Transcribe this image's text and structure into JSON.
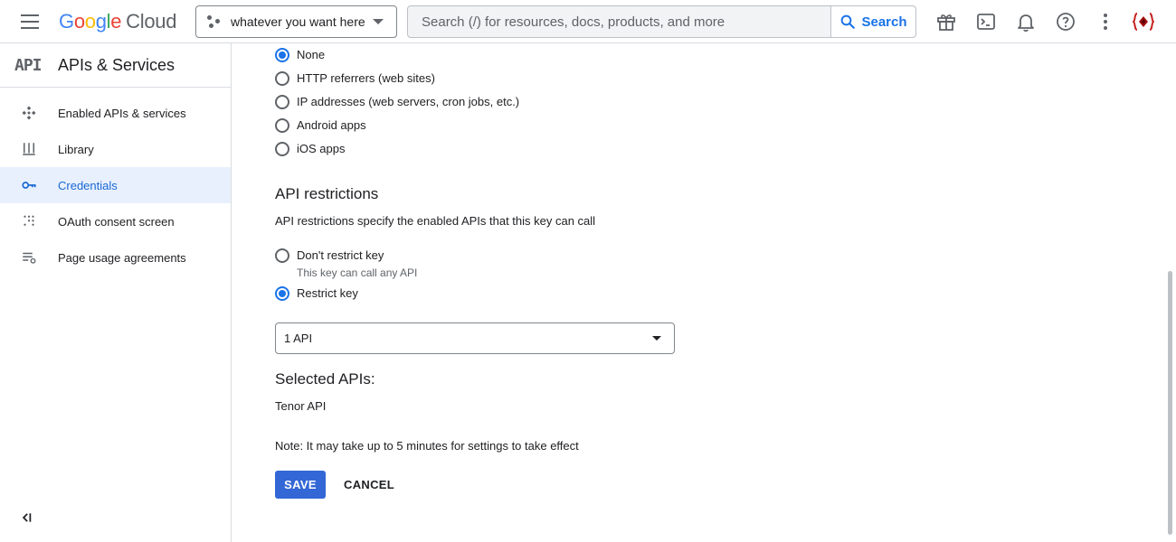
{
  "header": {
    "logo": {
      "G": "G",
      "o1": "o",
      "o2": "o",
      "g": "g",
      "l": "l",
      "e": "e",
      "cloud": "Cloud"
    },
    "project": "whatever you want here",
    "search": {
      "placeholder": "Search (/) for resources, docs, products, and more",
      "button_label": "Search"
    },
    "icons": [
      "gift-icon",
      "cloud-shell-icon",
      "notifications-icon",
      "help-icon",
      "more-vert-icon",
      "account-avatar"
    ],
    "accent_color": "#1a73e8"
  },
  "sidebar": {
    "logo_text": "API",
    "title": "APIs & Services",
    "items": [
      {
        "label": "Enabled APIs & services",
        "icon": "enabled-apis-icon",
        "active": false
      },
      {
        "label": "Library",
        "icon": "library-icon",
        "active": false
      },
      {
        "label": "Credentials",
        "icon": "key-icon",
        "active": true
      },
      {
        "label": "OAuth consent screen",
        "icon": "oauth-icon",
        "active": false
      },
      {
        "label": "Page usage agreements",
        "icon": "page-usage-icon",
        "active": false
      }
    ],
    "collapse_label": "<|"
  },
  "main": {
    "app_restrictions": {
      "options": [
        {
          "label": "None",
          "checked": true
        },
        {
          "label": "HTTP referrers (web sites)",
          "checked": false
        },
        {
          "label": "IP addresses (web servers, cron jobs, etc.)",
          "checked": false
        },
        {
          "label": "Android apps",
          "checked": false
        },
        {
          "label": "iOS apps",
          "checked": false
        }
      ]
    },
    "api_restrictions": {
      "title": "API restrictions",
      "description": "API restrictions specify the enabled APIs that this key can call",
      "options": [
        {
          "label": "Don't restrict key",
          "sublabel": "This key can call any API",
          "checked": false
        },
        {
          "label": "Restrict key",
          "checked": true
        }
      ],
      "select_value": "1 API"
    },
    "selected_apis": {
      "title": "Selected APIs:",
      "items": [
        "Tenor API"
      ]
    },
    "note": "Note: It may take up to 5 minutes for settings to take effect",
    "save_label": "SAVE",
    "cancel_label": "CANCEL"
  }
}
